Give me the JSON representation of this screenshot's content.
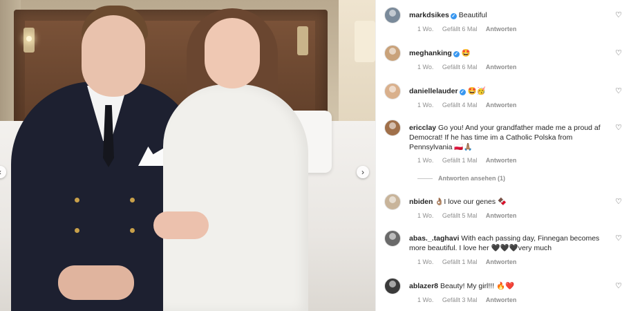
{
  "post": {
    "photo_alt_icon": "photo-image",
    "next_glyph": "›",
    "prev_glyph": "‹"
  },
  "colors": {
    "verified": "#3897f0",
    "meta_text": "#8e8e8e",
    "text": "#262626"
  },
  "comments": [
    {
      "user": "markdsikes",
      "verified": true,
      "text": "Beautiful",
      "time": "1 Wo.",
      "likes": "Gefällt 6 Mal",
      "reply_label": "Antworten",
      "avatar_color": "#7a8a9a"
    },
    {
      "user": "meghanking",
      "verified": true,
      "text": "🤩",
      "time": "1 Wo.",
      "likes": "Gefällt 6 Mal",
      "reply_label": "Antworten",
      "avatar_color": "#c9a27a"
    },
    {
      "user": "daniellelauder",
      "verified": true,
      "text": "🤩🥳",
      "time": "1 Wo.",
      "likes": "Gefällt 4 Mal",
      "reply_label": "Antworten",
      "avatar_color": "#d9b08c"
    },
    {
      "user": "ericclay",
      "verified": false,
      "text": "Go you! And your grandfather made me a proud af Democrat! If he has time im a Catholic Polska from Pennsylvania 🇵🇱🙏🏽",
      "time": "1 Wo.",
      "likes": "Gefällt 1 Mal",
      "reply_label": "Antworten",
      "avatar_color": "#a0704a",
      "view_replies": "Antworten ansehen (1)"
    },
    {
      "user": "nbiden",
      "verified": false,
      "text": "👌🏽I love our genes 🍫",
      "time": "1 Wo.",
      "likes": "Gefällt 5 Mal",
      "reply_label": "Antworten",
      "avatar_color": "#c8b49a"
    },
    {
      "user": "abas._.taghavi",
      "verified": false,
      "text": "With each passing day, Finnegan becomes more beautiful. I love her 🖤🖤🖤very much",
      "time": "1 Wo.",
      "likes": "Gefällt 1 Mal",
      "reply_label": "Antworten",
      "avatar_color": "#6a6a6a"
    },
    {
      "user": "ablazer8",
      "verified": false,
      "text": "Beauty! My girl!!! 🔥❤️",
      "time": "1 Wo.",
      "likes": "Gefällt 3 Mal",
      "reply_label": "Antworten",
      "avatar_color": "#3a3a3a"
    }
  ],
  "icons": {
    "heart": "♡",
    "verified": "✓"
  }
}
